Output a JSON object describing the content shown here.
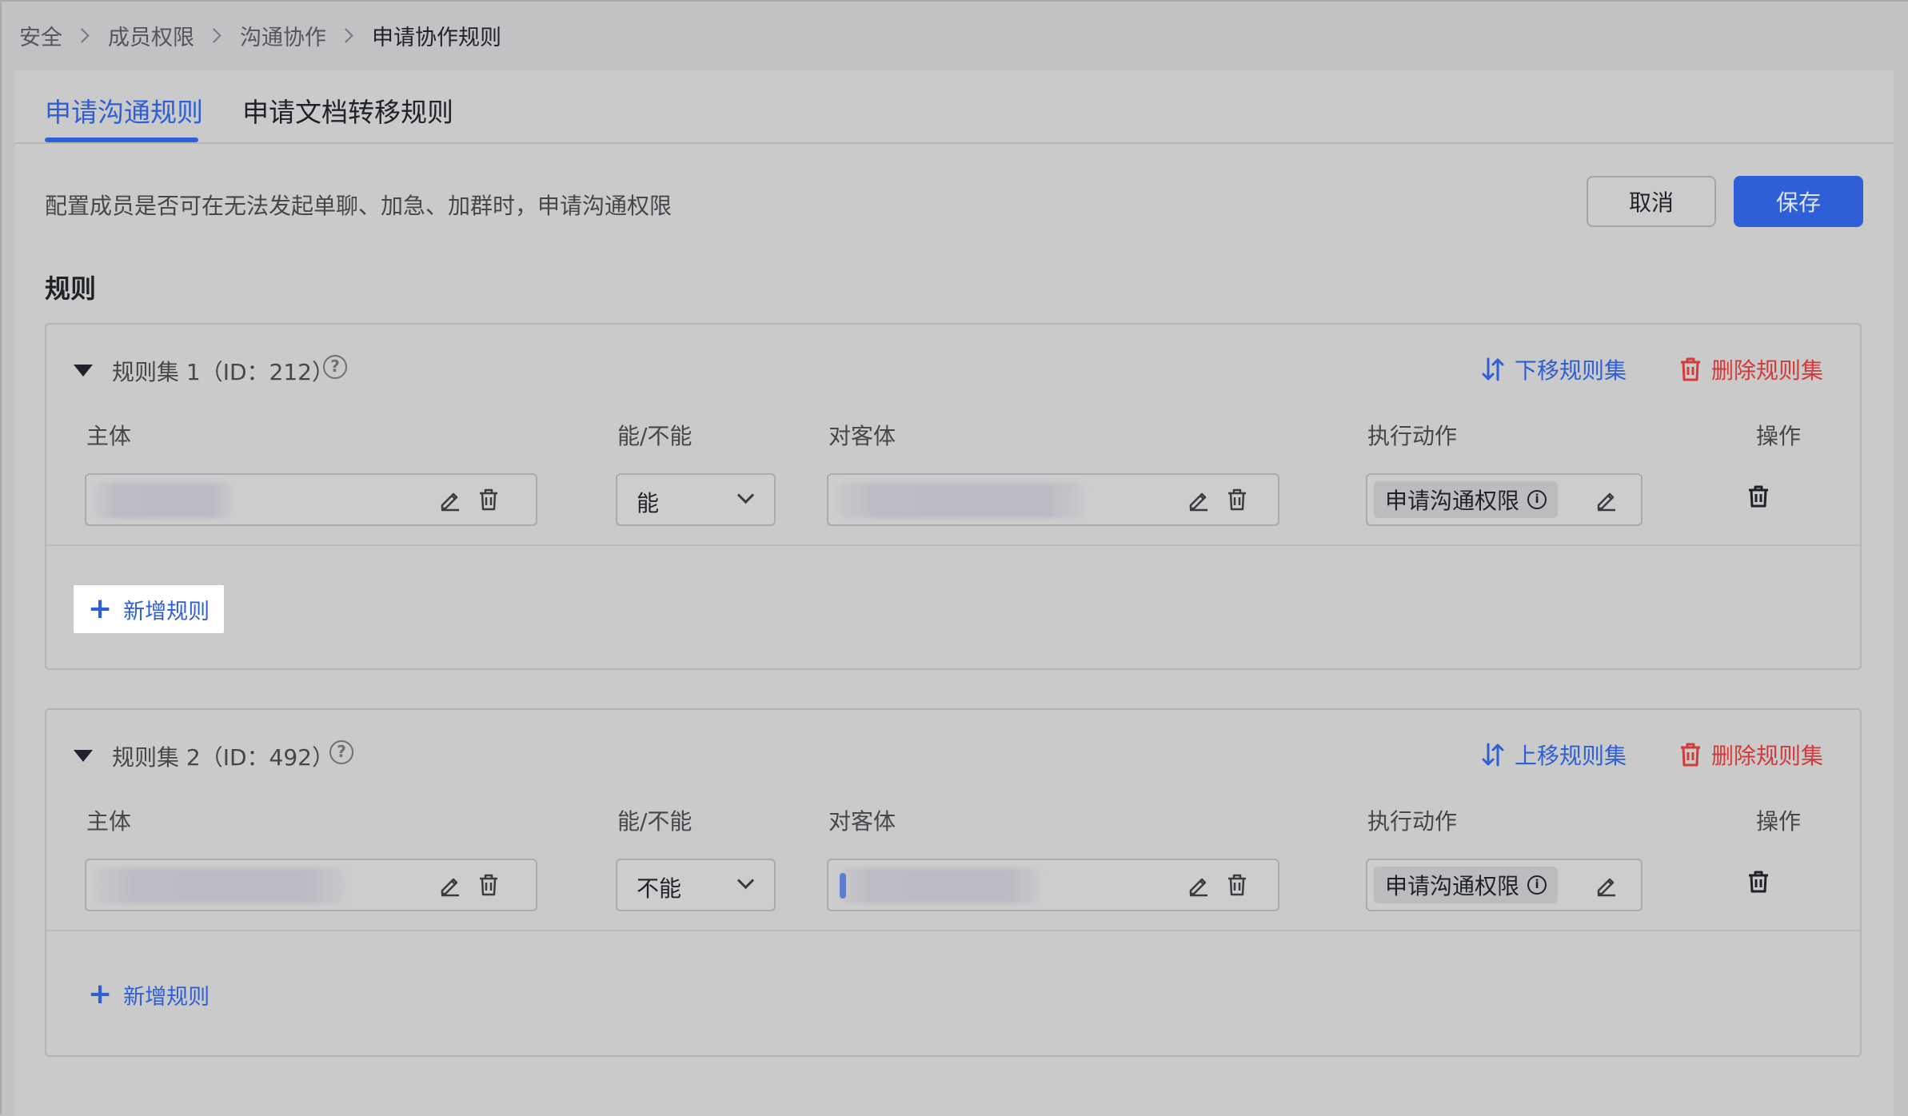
{
  "breadcrumb": {
    "items": [
      "安全",
      "成员权限",
      "沟通协作",
      "申请协作规则"
    ]
  },
  "tabs": [
    {
      "label": "申请沟通规则",
      "active": true
    },
    {
      "label": "申请文档转移规则",
      "active": false
    }
  ],
  "description": "配置成员是否可在无法发起单聊、加急、加群时，申请沟通权限",
  "actions": {
    "cancel_label": "取消",
    "save_label": "保存"
  },
  "section_title": "规则",
  "columns": {
    "subject": "主体",
    "can": "能/不能",
    "object": "对客体",
    "action": "执行动作",
    "operation": "操作"
  },
  "rulesets": [
    {
      "title": "规则集 1（ID：212）",
      "move_label": "下移规则集",
      "delete_label": "删除规则集",
      "rule": {
        "can_value": "能",
        "action_tag": "申请沟通权限"
      },
      "add_rule_label": "新增规则",
      "add_rule_highlighted": true
    },
    {
      "title": "规则集 2（ID：492）",
      "move_label": "上移规则集",
      "delete_label": "删除规则集",
      "rule": {
        "can_value": "不能",
        "action_tag": "申请沟通权限"
      },
      "add_rule_label": "新增规则",
      "add_rule_highlighted": false
    }
  ],
  "colors": {
    "accent": "#2f5fd6",
    "danger": "#d33a3a",
    "background": "#c2c2c4"
  }
}
